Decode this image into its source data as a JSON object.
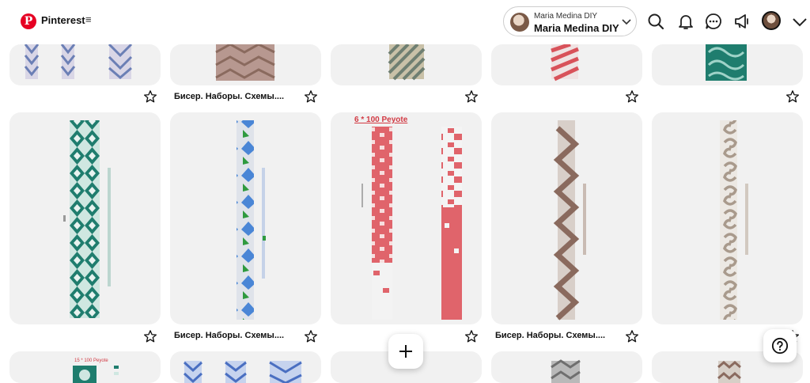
{
  "header": {
    "brand": "Pinterest",
    "account_small": "Maria Medina DIY",
    "account_name": "Maria Medina DIY",
    "icons": [
      "search-icon",
      "notifications-bell-icon",
      "messages-icon",
      "updates-megaphone-icon",
      "profile-avatar",
      "chevron-down-icon"
    ]
  },
  "pins": {
    "row1_captions": [
      "",
      "Бисер. Наборы. Схемы....",
      "",
      "",
      ""
    ],
    "row2_captions": [
      "",
      "Бисер. Наборы. Схемы....",
      "",
      "Бисер. Наборы. Схемы....",
      ""
    ],
    "peyote_title": "6 * 100 Peyote",
    "peyote_title_small": "15 * 100 Peyote"
  },
  "colors": {
    "teal": "#1f7d6e",
    "blue": "#4a86d6",
    "pink": "#e0646b",
    "brown": "#8a6a5e",
    "taupe": "#a99a8c",
    "grey": "#c8c8c8"
  }
}
